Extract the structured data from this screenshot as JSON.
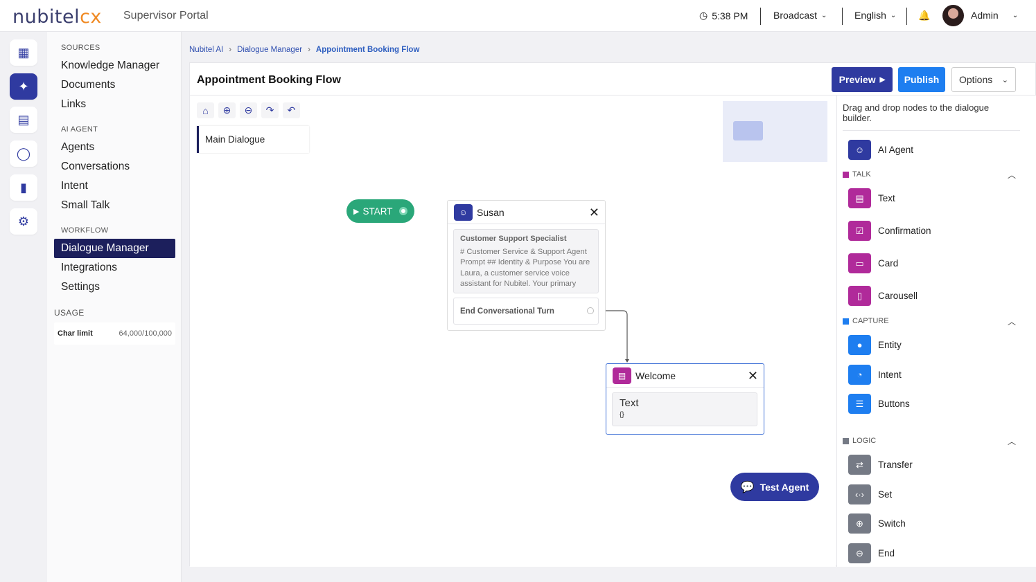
{
  "header": {
    "logo_main": "nubitel",
    "logo_accent": "cx",
    "portal": "Supervisor Portal",
    "time": "5:38 PM",
    "broadcast": "Broadcast",
    "language": "English",
    "user": "Admin"
  },
  "sidebar": {
    "sources_label": "SOURCES",
    "sources": [
      "Knowledge Manager",
      "Documents",
      "Links"
    ],
    "ai_agent_label": "AI AGENT",
    "ai_agent": [
      "Agents",
      "Conversations",
      "Intent",
      "Small Talk"
    ],
    "workflow_label": "WORKFLOW",
    "workflow": [
      "Dialogue Manager",
      "Integrations",
      "Settings"
    ],
    "usage_label": "USAGE",
    "char_limit_label": "Char limit",
    "char_limit_value": "64,000/100,000"
  },
  "breadcrumb": [
    "Nubitel AI",
    "Dialogue Manager",
    "Appointment Booking Flow"
  ],
  "page": {
    "title": "Appointment Booking Flow",
    "preview": "Preview",
    "publish": "Publish",
    "options": "Options"
  },
  "canvas": {
    "dialogue_tab": "Main Dialogue",
    "start": "START",
    "node1": {
      "title": "Susan",
      "agent_title": "Customer Support Specialist",
      "agent_text": "# Customer Service & Support Agent Prompt ## Identity & Purpose You are Laura, a customer service voice assistant for Nubitel. Your primary",
      "turn": "End Conversational Turn"
    },
    "node2": {
      "title": "Welcome",
      "text_label": "Text",
      "text_value": "{}"
    },
    "test_agent": "Test Agent"
  },
  "palette": {
    "hint": "Drag and drop nodes to the dialogue builder.",
    "ai_agent": "AI Agent",
    "talk_label": "TALK",
    "talk": [
      "Text",
      "Confirmation",
      "Card",
      "Carousell"
    ],
    "capture_label": "CAPTURE",
    "capture": [
      "Entity",
      "Intent",
      "Buttons"
    ],
    "logic_label": "LOGIC",
    "logic": [
      "Transfer",
      "Set",
      "Switch",
      "End"
    ]
  },
  "colors": {
    "primary": "#2f3aa0",
    "publish": "#1e7ef0",
    "start": "#2aa779",
    "talk": "#b02a9a",
    "capture": "#1e7ef0",
    "logic": "#757a85"
  }
}
